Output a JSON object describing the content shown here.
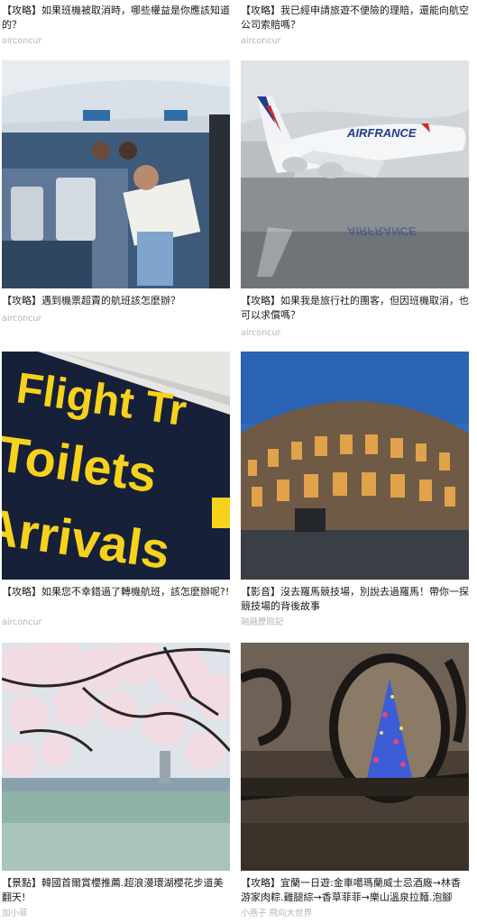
{
  "cards": [
    {
      "title": "【攻略】如果班機被取消時，哪些權益是你應該知道的？",
      "source": "airconcur",
      "image": "airplane-cabin-passengers-reading-newspaper"
    },
    {
      "title": "【攻略】我已經申請旅遊不便險的理賠，還能向航空公司索賠嗎？",
      "source": "airconcur",
      "image": "air-france-a380-on-wet-tarmac",
      "image_text": "AIRFRANCE"
    },
    {
      "title": "【攻略】遇到機票超賣的航班該怎麼辦？",
      "source": "airconcur",
      "image": "airport-sign-flight-transfer-toilets-arrivals",
      "image_text": [
        "Flight Tr",
        "Toilets",
        "Arrivals"
      ]
    },
    {
      "title": "【攻略】如果我是旅行社的團客，但因班機取消，也可以求償嗎？",
      "source": "airconcur",
      "image": "colosseum-at-dusk"
    },
    {
      "title": "【攻略】如果您不幸錯過了轉機航班，該怎麼辦呢?!",
      "source": "airconcur",
      "image": "cherry-blossoms-over-lake"
    },
    {
      "title": "【影音】沒去羅馬競技場，別說去過羅馬！帶你一探競技場的背後故事",
      "source": "融融歷險記",
      "image": "wrought-iron-railing-christmas-tree"
    },
    {
      "title": "【景點】韓國首爾賞櫻推薦.超浪漫環湖櫻花步道美翻天!",
      "source": "加小菲"
    },
    {
      "title": "【攻略】宜蘭一日遊:金車噶瑪蘭威士忌酒廠→林香游家肉粽.雞腿綜→香草菲菲→樂山溫泉拉麵.泡腳",
      "source": "小燕子 飛向大世界"
    }
  ]
}
